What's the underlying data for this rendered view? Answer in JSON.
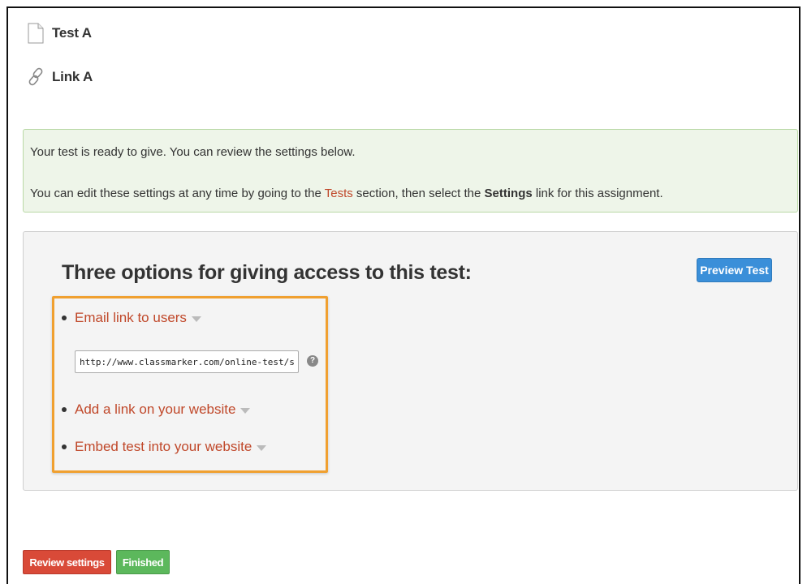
{
  "items": {
    "test": {
      "title": "Test A",
      "icon": "document-icon"
    },
    "link": {
      "title": "Link A",
      "icon": "link-icon"
    }
  },
  "notice": {
    "line1": "Your test is ready to give. You can review the settings below.",
    "line2_pre": "You can edit these settings at any time by going to the ",
    "line2_link": "Tests",
    "line2_mid": " section, then select the ",
    "line2_bold": "Settings",
    "line2_post": " link for this assignment."
  },
  "panel": {
    "heading": "Three options for giving access to this test:",
    "preview_button": "Preview Test",
    "options": [
      {
        "label": "Email link to users"
      },
      {
        "label": "Add a link on your website"
      },
      {
        "label": "Embed test into your website"
      }
    ],
    "url_value": "http://www.classmarker.com/online-test/start/?q",
    "help_glyph": "?"
  },
  "footer": {
    "review_button": "Review settings",
    "finished_button": "Finished"
  },
  "colors": {
    "link": "#c0482a",
    "notice_bg": "#eef5e9",
    "highlight_border": "#f0a030",
    "primary_button": "#3a8fd9",
    "danger_button": "#d94a38",
    "success_button": "#5cb85c"
  }
}
